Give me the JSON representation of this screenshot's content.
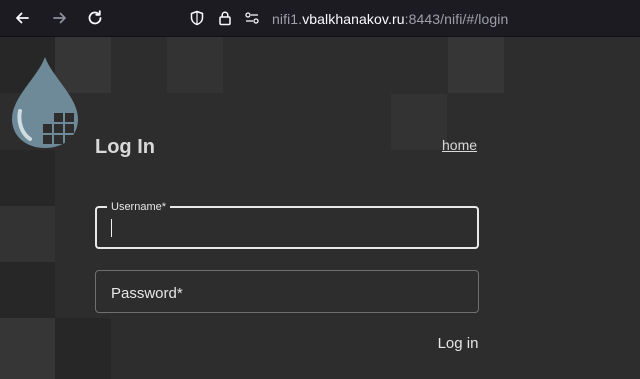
{
  "browser": {
    "back_icon": "arrow-left-icon",
    "forward_icon": "arrow-right-icon",
    "reload_icon": "reload-icon",
    "shield_icon": "shield-icon",
    "lock_icon": "lock-icon",
    "permissions_icon": "permissions-icon",
    "url_prefix": "nifi1.",
    "url_host": "vbalkhanakov.ru",
    "url_suffix": ":8443/nifi/#/login"
  },
  "login": {
    "title": "Log In",
    "home_link": "home",
    "username_label": "Username*",
    "username_value": "",
    "password_label": "Password*",
    "submit_label": "Log in"
  },
  "colors": {
    "background": "#2d2d2d",
    "toolbar": "#1c1b22",
    "logo_drop": "#6e8a98"
  }
}
